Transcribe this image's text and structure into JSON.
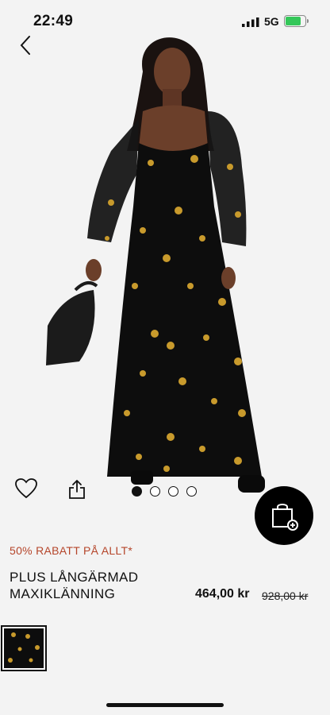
{
  "status_bar": {
    "time": "22:49",
    "network": "5G"
  },
  "product": {
    "promo": "50% RABATT PÅ ALLT*",
    "title": "PLUS LÅNGÄRMAD MAXIKLÄNNING",
    "price": "464,00 kr",
    "original_price": "928,00 kr"
  },
  "gallery": {
    "image_count": 4,
    "active_index": 0
  },
  "colors": {
    "accent_promo": "#b5452a",
    "background": "#f3f3f3",
    "dress": "#0d0d0d",
    "floral": "#c89a2c"
  },
  "icons": [
    "back-icon",
    "heart-icon",
    "share-icon",
    "shopping-bag-add-icon",
    "signal-icon",
    "battery-icon"
  ]
}
